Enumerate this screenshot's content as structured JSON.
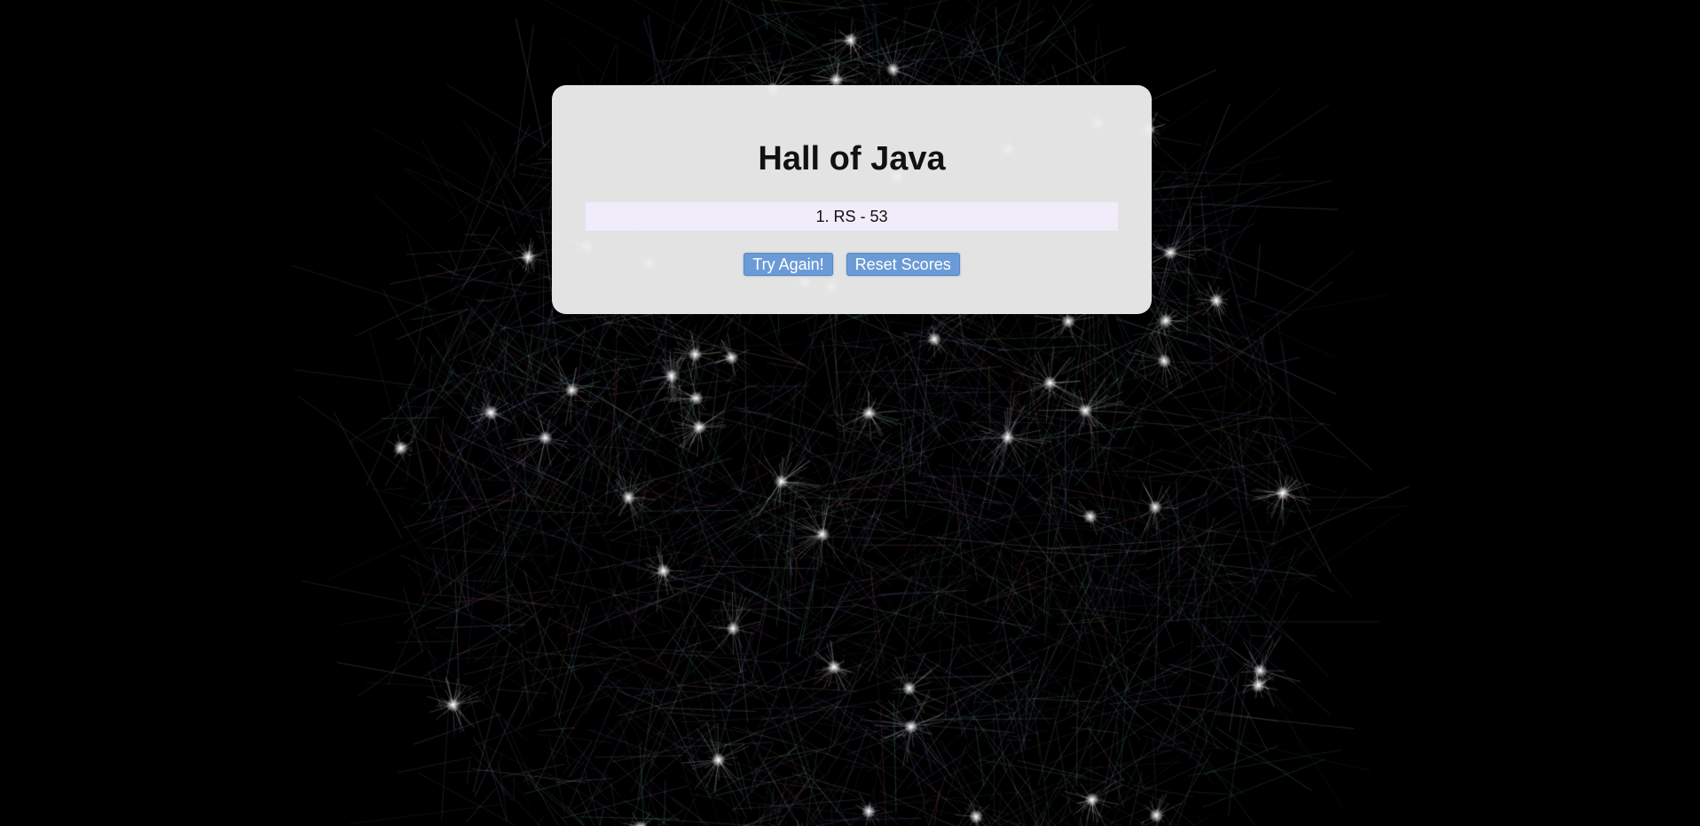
{
  "hall": {
    "title": "Hall of Java",
    "scores": [
      {
        "text": "1. RS - 53"
      }
    ]
  },
  "actions": {
    "try_again_label": "Try Again!",
    "reset_label": "Reset Scores"
  },
  "background": {
    "description_icon": "network-graph-icon",
    "base_color": "#000000"
  }
}
